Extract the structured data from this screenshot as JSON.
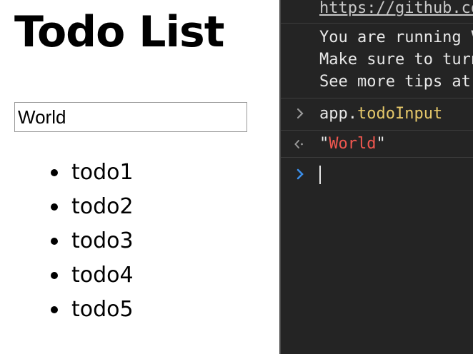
{
  "page": {
    "title": "Todo List",
    "input_value": "World",
    "todos": [
      "todo1",
      "todo2",
      "todo3",
      "todo4",
      "todo5"
    ]
  },
  "console": {
    "link": "https://github.com/vuejs/vue-devtools",
    "message_lines": [
      "You are running Vue in development mode.",
      "Make sure to turn on production mode when deploying for production.",
      "See more tips at https://vuejs.org/guide/deployment.html"
    ],
    "input_object": "app.",
    "input_property": "todoInput",
    "output_quote_open": "\"",
    "output_string": "World",
    "output_quote_close": "\""
  },
  "colors": {
    "console_background": "#242424",
    "property_color": "#e6c86a",
    "string_color": "#f0574f",
    "prompt_chevron": "#3b8eea"
  },
  "icons": {
    "input_chevron": "chevron-right-icon",
    "output_arrow": "return-arrow-icon",
    "prompt_chevron": "prompt-chevron-icon"
  }
}
